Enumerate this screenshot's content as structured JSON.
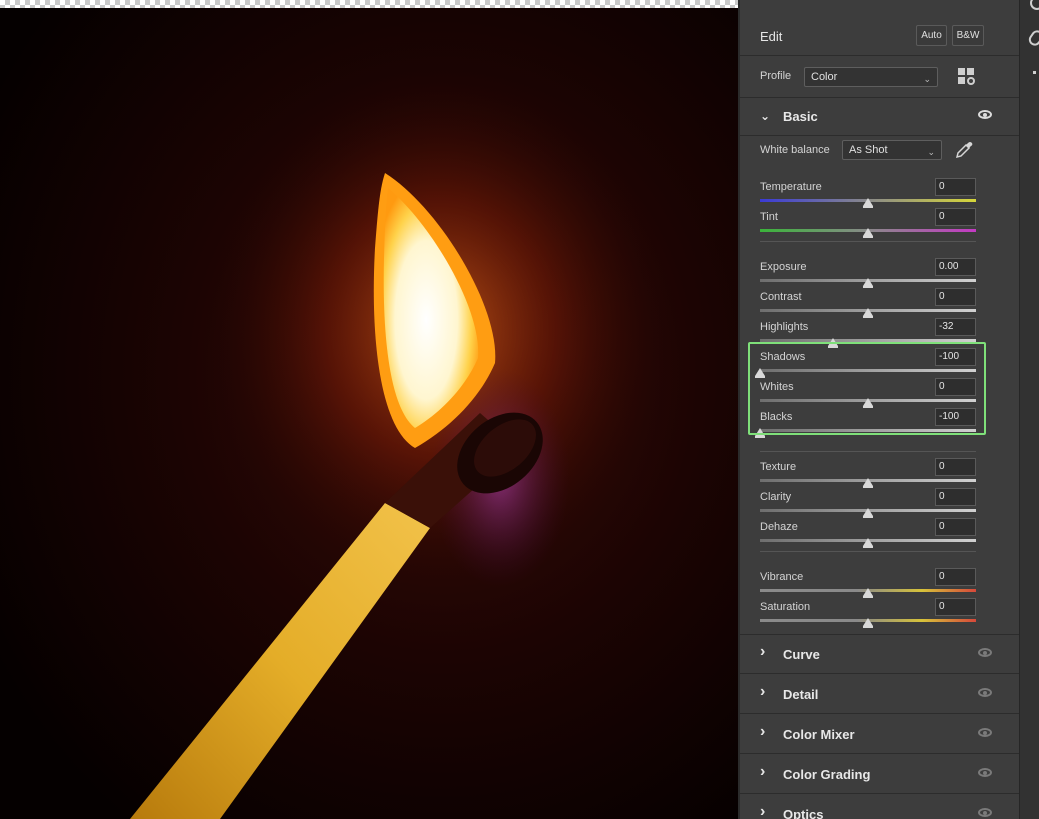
{
  "panel": {
    "title": "Edit",
    "auto_label": "Auto",
    "bw_label": "B&W",
    "profile_label": "Profile",
    "profile_value": "Color",
    "basic": {
      "label": "Basic",
      "white_balance_label": "White balance",
      "white_balance_value": "As Shot",
      "sliders": [
        {
          "label": "Temperature",
          "value": "0",
          "pos": 0.5,
          "track": "temperature"
        },
        {
          "label": "Tint",
          "value": "0",
          "pos": 0.5,
          "track": "tint"
        },
        {
          "label": "Exposure",
          "value": "0.00",
          "pos": 0.5,
          "track": "neutral"
        },
        {
          "label": "Contrast",
          "value": "0",
          "pos": 0.5,
          "track": "neutral"
        },
        {
          "label": "Highlights",
          "value": "-32",
          "pos": 0.34,
          "track": "neutral"
        },
        {
          "label": "Shadows",
          "value": "-100",
          "pos": 0.0,
          "track": "neutral"
        },
        {
          "label": "Whites",
          "value": "0",
          "pos": 0.5,
          "track": "neutral"
        },
        {
          "label": "Blacks",
          "value": "-100",
          "pos": 0.0,
          "track": "neutral"
        },
        {
          "label": "Texture",
          "value": "0",
          "pos": 0.5,
          "track": "neutral"
        },
        {
          "label": "Clarity",
          "value": "0",
          "pos": 0.5,
          "track": "neutral"
        },
        {
          "label": "Dehaze",
          "value": "0",
          "pos": 0.5,
          "track": "neutral"
        },
        {
          "label": "Vibrance",
          "value": "0",
          "pos": 0.5,
          "track": "vibrance"
        },
        {
          "label": "Saturation",
          "value": "0",
          "pos": 0.5,
          "track": "vibrance"
        }
      ]
    },
    "sections": [
      {
        "label": "Curve"
      },
      {
        "label": "Detail"
      },
      {
        "label": "Color Mixer"
      },
      {
        "label": "Color Grading"
      },
      {
        "label": "Optics"
      }
    ]
  },
  "colors": {
    "panel_bg": "#3d3d3d",
    "highlight_box": "#7fe07a",
    "flame_core": "#fffbe8",
    "match_stick": "#e0a21c"
  },
  "icons": {
    "white_balance_picker": "eyedropper-icon",
    "profile_browser": "grid-icon",
    "section_visibility": "eye-icon",
    "section_toggle": "chevron-right-icon"
  }
}
